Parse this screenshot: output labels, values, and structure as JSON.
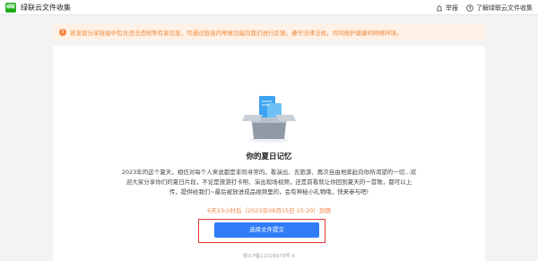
{
  "header": {
    "app_title": "绿联云文件收集",
    "logo_text": "绿联",
    "report_label": "举报",
    "learn_more_label": "了解绿联云文件收集"
  },
  "notice": {
    "text": "若发现分享链接中包含违法违规等有害信息，可通过链接内举报功能向我们进行反馈。遵守法律法规，共同维护健康的网络环境。"
  },
  "collection": {
    "title": "你的夏日记忆",
    "description": "2023年的这个夏天，相信对每个人来说都是非同寻常的。看演出、去旅游、再次自由地奔赴向你所渴望的一切…欢迎大家分享你们的夏日片段，不论是旅游打卡照、演出现场视频，还是前看就让你回到夏天的一首歌，都可以上传，提供给我们~最后被放进成品视频里的，会有神秘小礼物哦，快来参与吧!",
    "deadline": "6天23小时后（2023年08月15日 15:20）到期",
    "submit_label": "选择文件提交"
  },
  "footer": {
    "icp": "粤ICP备12028978号-6"
  },
  "colors": {
    "brand_green": "#1aad19",
    "primary_blue": "#2f7cf6",
    "warning_orange": "#f08a3c",
    "highlight_red": "#e53935"
  }
}
